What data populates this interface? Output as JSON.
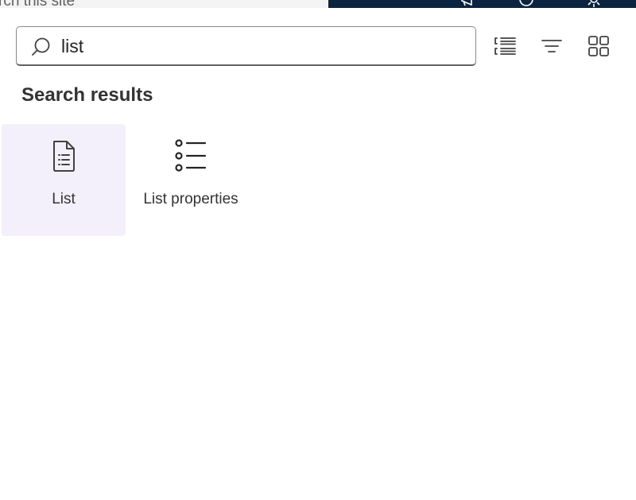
{
  "top_search": {
    "hint": "rch this site"
  },
  "top_nav": {
    "icons": [
      "megaphone-icon",
      "help-icon",
      "gear-icon"
    ]
  },
  "search": {
    "value": "list",
    "icon": "search-icon"
  },
  "toolbar": {
    "icons": [
      "list-view-icon",
      "filter-icon",
      "grid-view-icon"
    ]
  },
  "results": {
    "heading": "Search results",
    "items": [
      {
        "label": "List",
        "icon": "document-list-icon",
        "selected": true
      },
      {
        "label": "List properties",
        "icon": "bulleted-list-icon",
        "selected": false
      }
    ]
  },
  "colors": {
    "header_bg": "#0b2440",
    "selected_tile": "#f3f0fb"
  }
}
